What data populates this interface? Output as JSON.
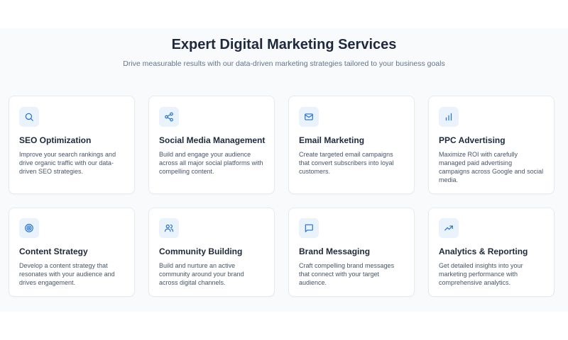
{
  "header": {
    "title": "Expert Digital Marketing Services",
    "subtitle": "Drive measurable results with our data-driven marketing strategies tailored to your business goals"
  },
  "colors": {
    "accent": "#1d6fd6",
    "icon_bg": "#eaf2fc",
    "section_bg": "#f8fafc"
  },
  "services": [
    {
      "icon": "search-icon",
      "title": "SEO Optimization",
      "description": "Improve your search rankings and drive organic traffic with our data-driven SEO strategies."
    },
    {
      "icon": "share-icon",
      "title": "Social Media Management",
      "description": "Build and engage your audience across all major social platforms with compelling content."
    },
    {
      "icon": "mail-icon",
      "title": "Email Marketing",
      "description": "Create targeted email campaigns that convert subscribers into loyal customers."
    },
    {
      "icon": "bar-chart-icon",
      "title": "PPC Advertising",
      "description": "Maximize ROI with carefully managed paid advertising campaigns across Google and social media."
    },
    {
      "icon": "target-icon",
      "title": "Content Strategy",
      "description": "Develop a content strategy that resonates with your audience and drives engagement."
    },
    {
      "icon": "users-icon",
      "title": "Community Building",
      "description": "Build and nurture an active community around your brand across digital channels."
    },
    {
      "icon": "message-icon",
      "title": "Brand Messaging",
      "description": "Craft compelling brand messages that connect with your target audience."
    },
    {
      "icon": "trending-up-icon",
      "title": "Analytics & Reporting",
      "description": "Get detailed insights into your marketing performance with comprehensive analytics."
    }
  ]
}
